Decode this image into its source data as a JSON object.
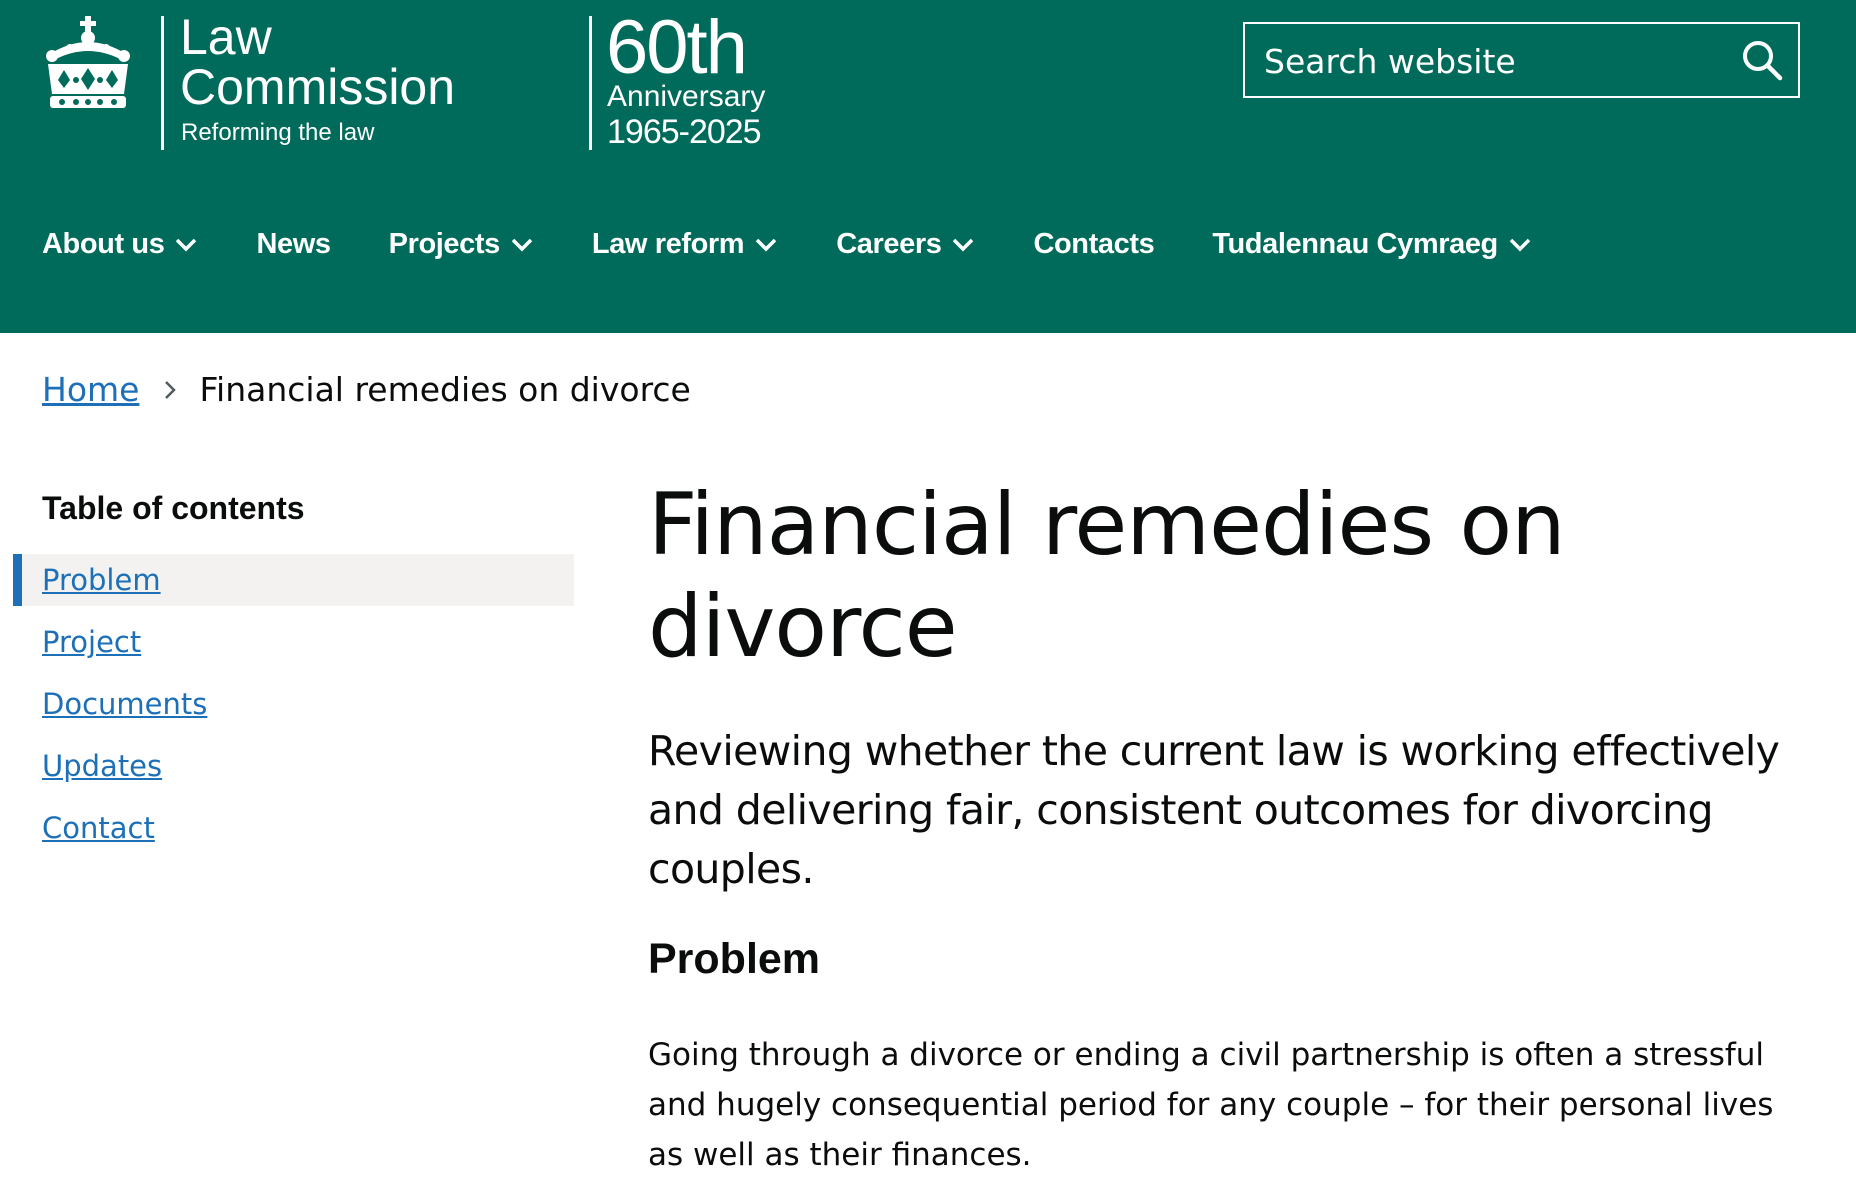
{
  "header": {
    "logo": {
      "title_line1": "Law",
      "title_line2": "Commission",
      "tagline": "Reforming the law",
      "icon": "royal-crown-icon"
    },
    "anniversary": {
      "number": "60th",
      "label": "Anniversary",
      "years": "1965-2025"
    },
    "search": {
      "placeholder": "Search website",
      "icon": "search-icon"
    },
    "nav": {
      "items": [
        {
          "label": "About us",
          "has_dropdown": true
        },
        {
          "label": "News",
          "has_dropdown": false
        },
        {
          "label": "Projects",
          "has_dropdown": true
        },
        {
          "label": "Law reform",
          "has_dropdown": true
        },
        {
          "label": "Careers",
          "has_dropdown": true
        },
        {
          "label": "Contacts",
          "has_dropdown": false
        },
        {
          "label": "Tudalennau Cymraeg",
          "has_dropdown": true
        }
      ]
    }
  },
  "breadcrumb": {
    "home": "Home",
    "current": "Financial remedies on divorce"
  },
  "toc": {
    "heading": "Table of contents",
    "items": [
      {
        "label": "Problem",
        "active": true
      },
      {
        "label": "Project",
        "active": false
      },
      {
        "label": "Documents",
        "active": false
      },
      {
        "label": "Updates",
        "active": false
      },
      {
        "label": "Contact",
        "active": false
      }
    ]
  },
  "main": {
    "title": "Financial remedies on divorce",
    "lede": "Reviewing whether the current law is working effectively and delivering fair, consistent outcomes for divorcing couples.",
    "section_heading": "Problem",
    "body": "Going through a divorce or ending a civil partnership is often a stressful and hugely consequential period for any couple – for their personal lives as well as their finances."
  },
  "colors": {
    "header_bg": "#006b5a",
    "link": "#1d70b8",
    "toc_active_bg": "#f3f2f1",
    "text": "#0b0c0c"
  }
}
